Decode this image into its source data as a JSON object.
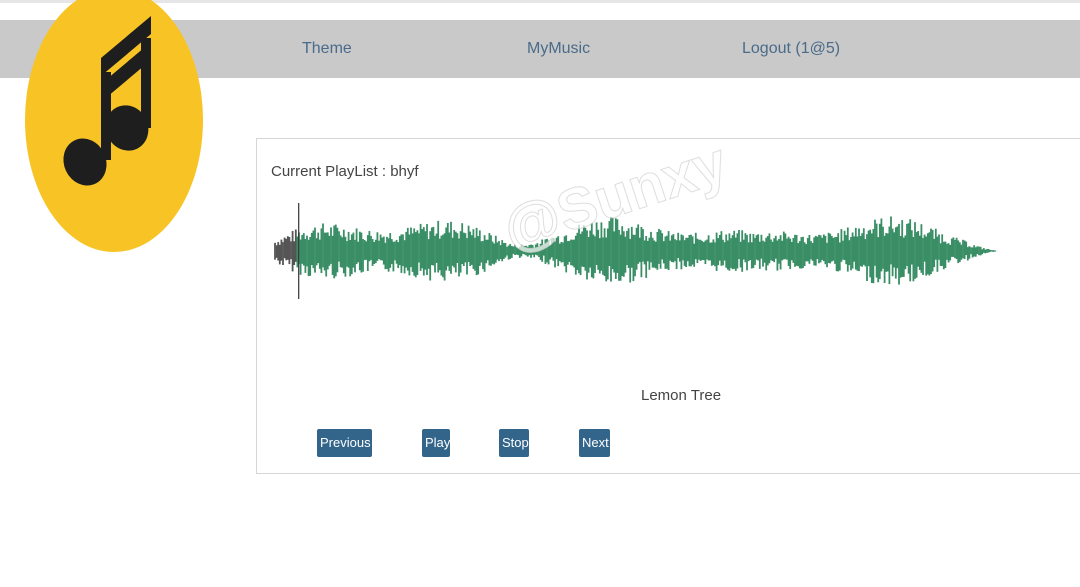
{
  "nav": {
    "theme": "Theme",
    "mymusic": "MyMusic",
    "logout": "Logout (1@5)"
  },
  "logo": {
    "icon": "music-note-icon",
    "bg_color": "#F7C325",
    "note_color": "#1E1E1E"
  },
  "player": {
    "playlist_label": "Current PlayList : bhyf",
    "track_title": "Lemon Tree",
    "progress": 0.03,
    "waveform_color": "#3A8E66",
    "played_color": "#555555",
    "buttons": {
      "previous": "Previous",
      "play": "Play",
      "stop": "Stop",
      "next": "Next"
    }
  },
  "watermark": "@Sunxy",
  "colors": {
    "navbar": "#C9C9C9",
    "button": "#33658A",
    "link": "#4A6B8A"
  }
}
